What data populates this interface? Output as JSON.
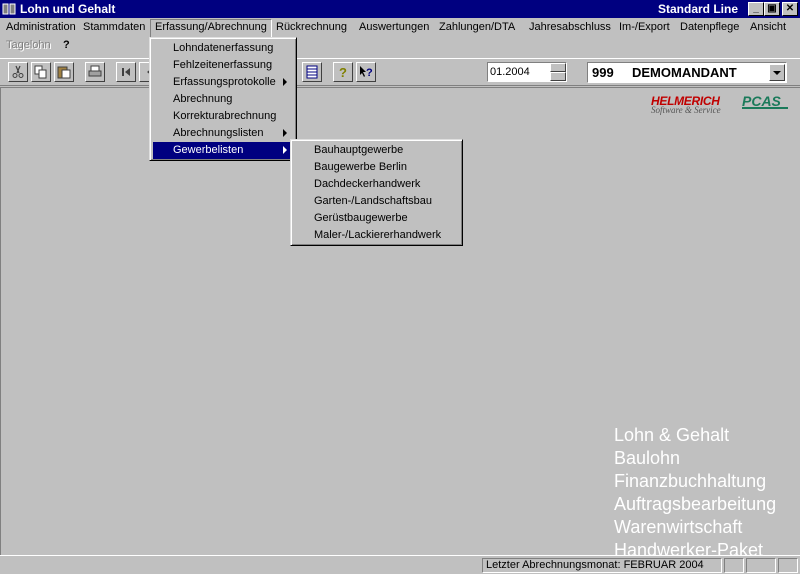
{
  "window": {
    "title": "Lohn und Gehalt",
    "edition": "Standard Line",
    "minimize_glyph": "_",
    "maximize_glyph": "▣",
    "close_glyph": "✕"
  },
  "menubar": {
    "items": [
      {
        "label": "Administration"
      },
      {
        "label": "Stammdaten"
      },
      {
        "label": "Erfassung/Abrechnung"
      },
      {
        "label": "Rückrechnung"
      },
      {
        "label": "Auswertungen"
      },
      {
        "label": "Zahlungen/DTA"
      },
      {
        "label": "Jahresabschluss"
      },
      {
        "label": "Im-/Export"
      },
      {
        "label": "Datenpflege"
      },
      {
        "label": "Ansicht"
      },
      {
        "label": "Tagelohn"
      },
      {
        "label": "?"
      }
    ]
  },
  "erfassung_menu": {
    "items": [
      {
        "label": "Lohndatenerfassung"
      },
      {
        "label": "Fehlzeitenerfassung"
      },
      {
        "label": "Erfassungsprotokolle"
      },
      {
        "label": "Abrechnung"
      },
      {
        "label": "Korrekturabrechnung"
      },
      {
        "label": "Abrechnungslisten"
      },
      {
        "label": "Gewerbelisten"
      }
    ]
  },
  "gewerbe_submenu": {
    "items": [
      {
        "label": "Bauhauptgewerbe"
      },
      {
        "label": "Baugewerbe Berlin"
      },
      {
        "label": "Dachdeckerhandwerk"
      },
      {
        "label": "Garten-/Landschaftsbau"
      },
      {
        "label": "Gerüstbaugewerbe"
      },
      {
        "label": "Maler-/Lackiererhandwerk"
      }
    ]
  },
  "toolbar": {
    "period_value": "01.2004",
    "mandant_number": "999",
    "mandant_name": "DEMOMANDANT",
    "icons": [
      "cut-icon",
      "copy-icon",
      "paste-icon",
      "print-icon",
      "first-record-icon",
      "prev-record-icon",
      "table-icon",
      "help-icon",
      "context-help-icon"
    ]
  },
  "logos": {
    "helmerich": "HELMERICH",
    "helmerich_sub": "Software & Service",
    "pcas": "PCAS"
  },
  "products": {
    "items": [
      {
        "label": "Lohn & Gehalt"
      },
      {
        "label": "Baulohn"
      },
      {
        "label": "Finanzbuchhaltung"
      },
      {
        "label": "Auftragsbearbeitung"
      },
      {
        "label": "Warenwirtschaft"
      },
      {
        "label": "Handwerker-Paket"
      }
    ]
  },
  "statusbar": {
    "message": "Letzter Abrechnungsmonat: FEBRUAR 2004"
  },
  "colors": {
    "titlebar": "#000080",
    "face": "#c0c0c0",
    "highlight": "#000080",
    "helmerich_red": "#c00000",
    "pcas_green": "#1a7a5a"
  }
}
